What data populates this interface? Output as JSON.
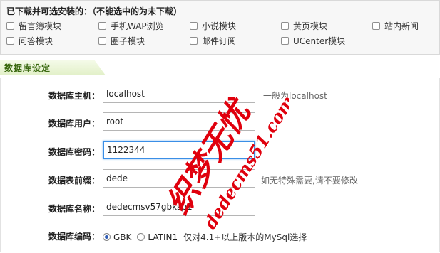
{
  "modules": {
    "title": "已下载并可选安装的：（不能选中的为未下载）",
    "items": [
      {
        "label": "留言簿模块"
      },
      {
        "label": "手机WAP浏览"
      },
      {
        "label": "小说模块"
      },
      {
        "label": "黄页模块"
      },
      {
        "label": "站内新闻"
      },
      {
        "label": "问答模块"
      },
      {
        "label": "圈子模块"
      },
      {
        "label": "邮件订阅"
      },
      {
        "label": "UCenter模块"
      }
    ]
  },
  "db_section": {
    "title": "数据库设定",
    "fields": {
      "host": {
        "label": "数据库主机：",
        "value": "localhost",
        "hint": "一般为localhost"
      },
      "user": {
        "label": "数据库用户：",
        "value": "root"
      },
      "pass": {
        "label": "数据库密码：",
        "value": "1122344"
      },
      "prefix": {
        "label": "数据表前缀：",
        "value": "dede_",
        "hint": "如无特殊需要,请不要修改"
      },
      "name": {
        "label": "数据库名称：",
        "value": "dedecmsv57gbksp1"
      },
      "charset": {
        "label": "数据库编码：",
        "options": [
          "GBK",
          "LATIN1"
        ],
        "selected": "GBK",
        "note": "仅对4.1+以上版本的MySql选择"
      }
    }
  },
  "watermark": {
    "text": "织梦无忧 dedecms51.com"
  },
  "colors": {
    "focus_border": "#3a8ee6",
    "section_title": "#3c6a12",
    "watermark": "#e0000d"
  }
}
